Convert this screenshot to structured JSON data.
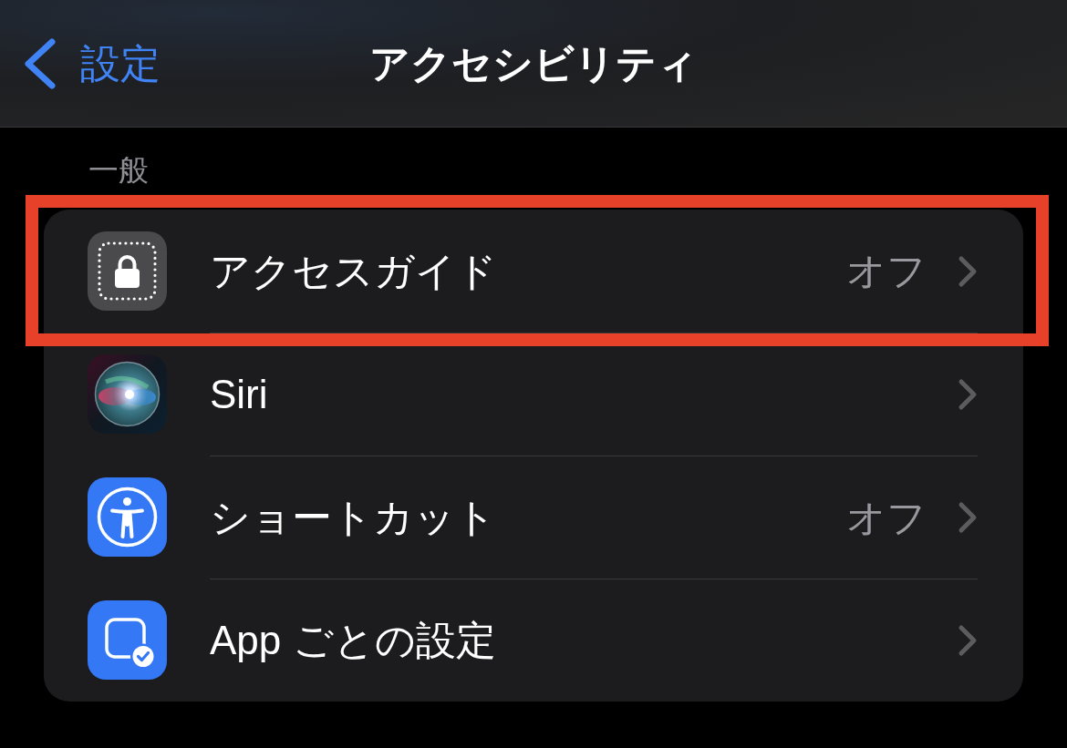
{
  "nav": {
    "back_label": "設定",
    "title": "アクセシビリティ"
  },
  "section": {
    "header": "一般",
    "rows": [
      {
        "kind": "guided-access",
        "label": "アクセスガイド",
        "value": "オフ",
        "highlighted": true
      },
      {
        "kind": "siri",
        "label": "Siri",
        "highlighted": false
      },
      {
        "kind": "shortcut",
        "label": "ショートカット",
        "value": "オフ",
        "highlighted": false
      },
      {
        "kind": "per-app",
        "label": "App ごとの設定",
        "highlighted": false
      }
    ]
  }
}
